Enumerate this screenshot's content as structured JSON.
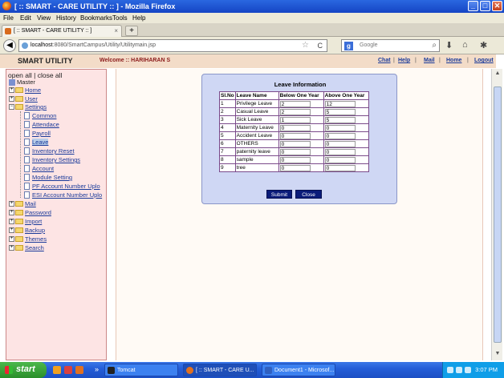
{
  "window": {
    "title": "[ :: SMART - CARE UTILITY :: ] - Mozilla Firefox",
    "min": "_",
    "max": "□",
    "close": "✕"
  },
  "menu": [
    "File",
    "Edit",
    "View",
    "History",
    "Bookmarks",
    "Tools",
    "Help"
  ],
  "tab": {
    "label": "[ :: SMART - CARE UTILITY :: ]",
    "close": "×",
    "new": "+"
  },
  "nav": {
    "back": "◀",
    "url_host": "localhost",
    "url_rest": ":8080/SmartCampus/Utility/Utilitymain.jsp",
    "star": "☆",
    "reload": "C",
    "search_engine": "g",
    "search_placeholder": "Google",
    "search_icon": "⌕",
    "download_icon": "⬇",
    "home_icon": "⌂",
    "addon_icon": "✱"
  },
  "header": {
    "brand": "SMART UTILITY",
    "welcome": "Welcome :: HARIHARAN S",
    "links": [
      "Chat",
      "Help",
      "Mail",
      "Home",
      "Logout"
    ]
  },
  "sidebar": {
    "open_close": "open all | close all",
    "root": "Master",
    "top_folders": [
      {
        "label": "Home"
      },
      {
        "label": "User"
      },
      {
        "label": "Settings"
      }
    ],
    "settings_items": [
      {
        "label": "Common"
      },
      {
        "label": "Attendace"
      },
      {
        "label": "Payroll"
      },
      {
        "label": "Leave"
      },
      {
        "label": "Inventory Reset"
      },
      {
        "label": "Inventory Settings"
      },
      {
        "label": "Account"
      },
      {
        "label": "Module Setting"
      },
      {
        "label": "PF Account Number Uplo"
      },
      {
        "label": "ESI Account Number Uplo"
      }
    ],
    "bottom_folders": [
      {
        "label": "Mail"
      },
      {
        "label": "Password"
      },
      {
        "label": "Import"
      },
      {
        "label": "Backup"
      },
      {
        "label": "Themes"
      },
      {
        "label": "Search"
      }
    ]
  },
  "leave_form": {
    "title": "Leave Information",
    "headers": [
      "Sl.No",
      "Leave Name",
      "Below One Year",
      "Above One Year"
    ],
    "rows": [
      {
        "sl": "1",
        "name": "Privilege Leave",
        "below": "2",
        "above": "12"
      },
      {
        "sl": "2",
        "name": "Casual Leave",
        "below": "2",
        "above": "5"
      },
      {
        "sl": "3",
        "name": "Sick Leave",
        "below": "1",
        "above": "5"
      },
      {
        "sl": "4",
        "name": "Maternity Leave",
        "below": "0",
        "above": "0"
      },
      {
        "sl": "5",
        "name": "Accident Leave",
        "below": "0",
        "above": "0"
      },
      {
        "sl": "6",
        "name": "OTHERS",
        "below": "0",
        "above": "0"
      },
      {
        "sl": "7",
        "name": "paternity leave",
        "below": "0",
        "above": "0"
      },
      {
        "sl": "8",
        "name": "sample",
        "below": "0",
        "above": "0"
      },
      {
        "sl": "9",
        "name": "tree",
        "below": "0",
        "above": "0"
      }
    ],
    "submit": "Submit",
    "close": "Close"
  },
  "taskbar": {
    "start": "start",
    "chevron": "»",
    "items": [
      {
        "label": "Tomcat"
      },
      {
        "label": "[ :: SMART - CARE U..."
      },
      {
        "label": "Document1 - Microsof..."
      }
    ],
    "clock": "3:07 PM"
  }
}
